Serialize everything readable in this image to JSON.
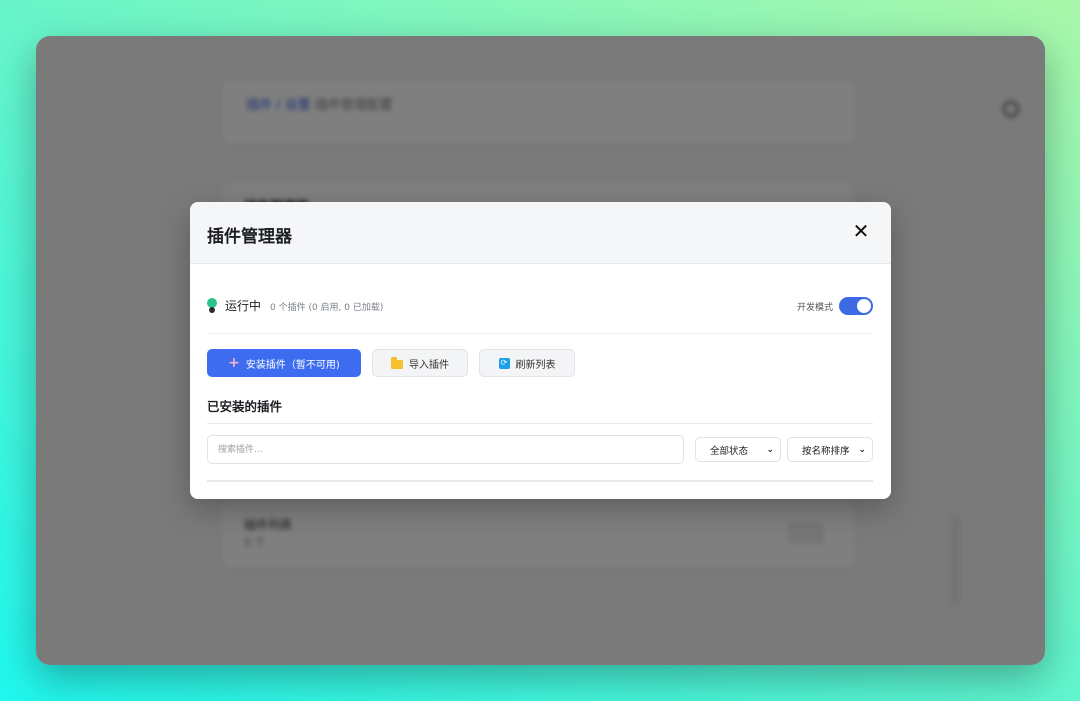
{
  "background": {
    "breadcrumb_link": "插件 / 设置",
    "breadcrumb_rest": "插件管理配置",
    "section_title": "插件管理器",
    "item_title": "插件列表",
    "item_subtitle": "0 个"
  },
  "modal": {
    "title": "插件管理器",
    "close_symbol": "✕"
  },
  "status": {
    "label": "运行中",
    "detail": "0 个插件 (0 启用, 0 已加载)",
    "color": "#2bc48a"
  },
  "dev_mode": {
    "label": "开发模式",
    "enabled": true,
    "color": "#3c6ae4"
  },
  "actions": {
    "install_label": "安装插件（暂不可用)",
    "import_label": "导入插件",
    "refresh_label": "刷新列表"
  },
  "installed": {
    "title": "已安装的插件",
    "search_placeholder": "搜索插件...",
    "filter_selected": "全部状态",
    "sort_selected": "按名称排序"
  },
  "colors": {
    "primary": "#3d6cf0",
    "accent_folder": "#f5c12e",
    "accent_refresh": "#1ea0e8"
  }
}
